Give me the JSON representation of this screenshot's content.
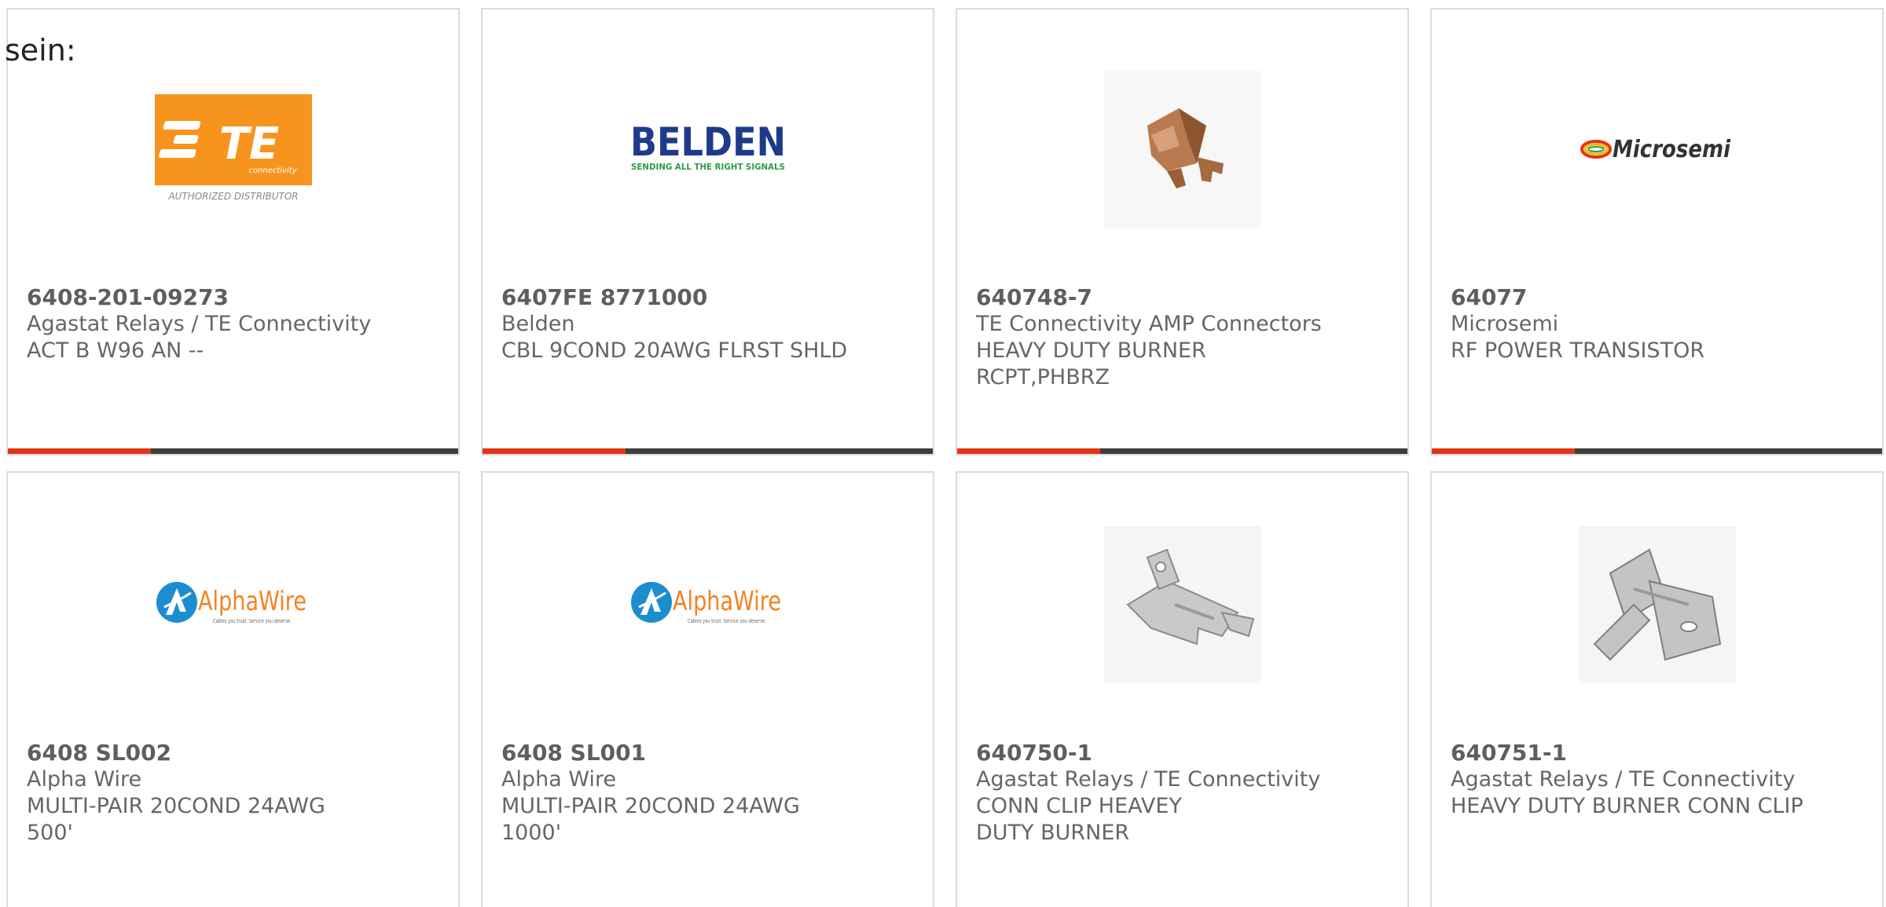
{
  "intro_text": "sein:",
  "colors": {
    "accent": "#e63312",
    "bar": "#3e3e3e",
    "border": "#dcdcdc",
    "text": "#666666",
    "te_orange": "#f7941d",
    "belden_blue": "#1e3a8a",
    "belden_green": "#2e9a4a",
    "alphawire_orange": "#f58220",
    "alphawire_blue": "#1c8ecf"
  },
  "products": [
    {
      "part_number": "6408-201-09273",
      "manufacturer": "Agastat Relays / TE Connectivity",
      "description": "ACT B W96 AN --",
      "image": "te-connectivity-logo",
      "logo_text": {
        "main": "TE",
        "sub": "connectivity",
        "caption": "AUTHORIZED DISTRIBUTOR"
      }
    },
    {
      "part_number": "6407FE 8771000",
      "manufacturer": "Belden",
      "description": "CBL 9COND 20AWG FLRST SHLD",
      "image": "belden-logo",
      "logo_text": {
        "main": "BELDEN",
        "sub": "SENDING ALL THE RIGHT SIGNALS"
      }
    },
    {
      "part_number": "640748-7",
      "manufacturer": "TE Connectivity AMP Connectors",
      "description": "HEAVY DUTY BURNER RCPT,PHBRZ",
      "image": "connector-photo"
    },
    {
      "part_number": "64077",
      "manufacturer": "Microsemi",
      "description": "RF POWER TRANSISTOR",
      "image": "microsemi-logo",
      "logo_text": {
        "main": "Microsemi"
      }
    },
    {
      "part_number": "6408 SL002",
      "manufacturer": "Alpha Wire",
      "description": "MULTI-PAIR 20COND 24AWG 500'",
      "image": "alphawire-logo",
      "logo_text": {
        "main": "AlphaWire",
        "sub": "Cables you trust. Service you deserve."
      }
    },
    {
      "part_number": "6408 SL001",
      "manufacturer": "Alpha Wire",
      "description": "MULTI-PAIR 20COND 24AWG 1000'",
      "image": "alphawire-logo",
      "logo_text": {
        "main": "AlphaWire",
        "sub": "Cables you trust. Service you deserve."
      }
    },
    {
      "part_number": "640750-1",
      "manufacturer": "Agastat Relays / TE Connectivity",
      "description": "CONN CLIP HEAVEY DUTY BURNER",
      "image": "clip-photo"
    },
    {
      "part_number": "640751-1",
      "manufacturer": "Agastat Relays / TE Connectivity",
      "description": "HEAVY DUTY BURNER CONN CLIP",
      "image": "clip-photo"
    }
  ]
}
